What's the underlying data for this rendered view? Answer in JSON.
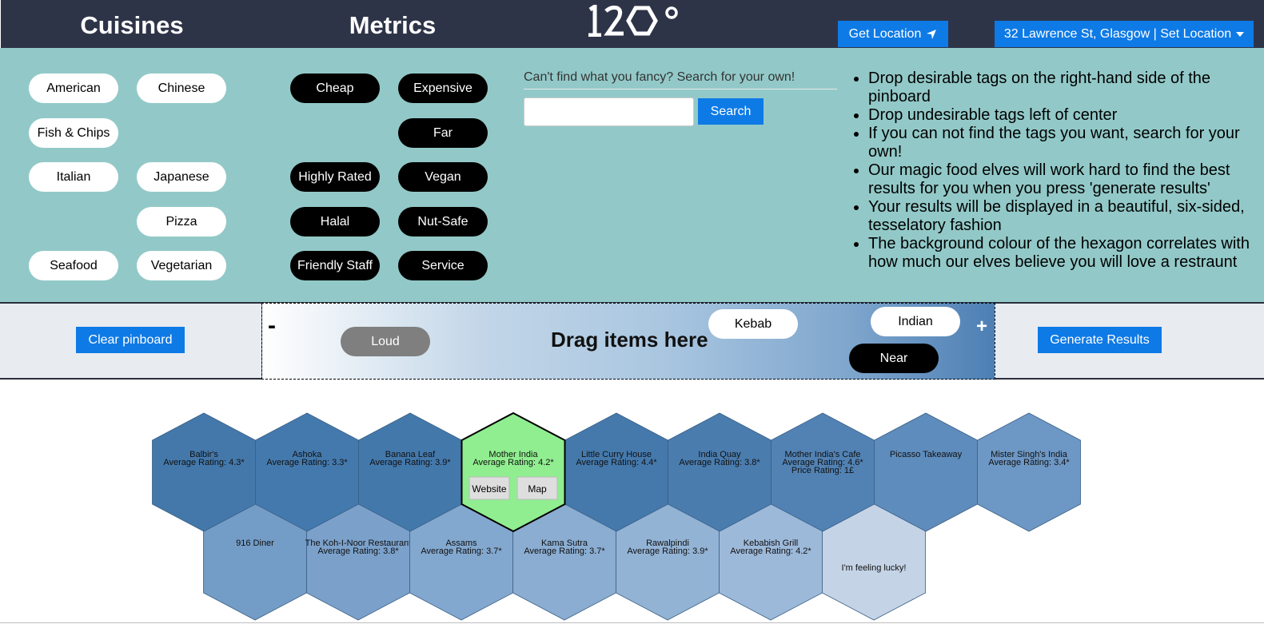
{
  "header": {
    "cuisines_title": "Cuisines",
    "metrics_title": "Metrics",
    "logo_text": "120°",
    "get_location_label": "Get Location",
    "location_label": "32 Lawrence St, Glasgow | Set Location"
  },
  "cuisines": [
    "American",
    "Chinese",
    "Fish & Chips",
    "Italian",
    "Japanese",
    "Pizza",
    "Seafood",
    "Vegetarian"
  ],
  "metrics": [
    "Cheap",
    "Expensive",
    "Far",
    "Highly Rated",
    "Vegan",
    "Halal",
    "Nut-Safe",
    "Friendly Staff",
    "Service"
  ],
  "search": {
    "label": "Can't find what you fancy? Search for your own!",
    "value": "",
    "button_label": "Search"
  },
  "instructions": [
    "Drop desirable tags on the right-hand side of the pinboard",
    "Drop undesirable tags left of center",
    "If you can not find the tags you want, search for your own!",
    "Our magic food elves will work hard to find the best results for you when you press 'generate results'",
    "Your results will be displayed in a beautiful, six-sided, tesselatory fashion",
    "The background colour of the hexagon correlates with how much our elves believe you will love a restraunt"
  ],
  "pinboard": {
    "clear_label": "Clear pinboard",
    "generate_label": "Generate Results",
    "drop_text": "Drag items here",
    "minus": "-",
    "plus": "+",
    "pinned": [
      "Loud",
      "Kebab",
      "Indian",
      "Near"
    ]
  },
  "results": {
    "row1": [
      {
        "name": "Balbir's",
        "rating": "Average Rating: 4.3*",
        "color": "#4478ab"
      },
      {
        "name": "Ashoka",
        "rating": "Average Rating: 3.3*",
        "color": "#4479ad"
      },
      {
        "name": "Banana Leaf",
        "rating": "Average Rating: 3.9*",
        "color": "#4378ab"
      },
      {
        "name": "Mother India",
        "rating": "Average Rating: 4.2*",
        "color": "#90ee90",
        "selected": true,
        "website_label": "Website",
        "map_label": "Map"
      },
      {
        "name": "Little Curry House",
        "rating": "Average Rating: 4.4*",
        "color": "#4579ac"
      },
      {
        "name": "India Quay",
        "rating": "Average Rating: 3.8*",
        "color": "#4a7cae"
      },
      {
        "name": "Mother India's Cafe",
        "rating": "Average Rating: 4.6*",
        "price": "Price Rating: 1£",
        "color": "#5282b4"
      },
      {
        "name": "Picasso Takeaway",
        "rating": "",
        "color": "#5e8cbc"
      },
      {
        "name": "Mister Singh's India",
        "rating": "Average Rating: 3.4*",
        "color": "#6d97c4"
      }
    ],
    "row2": [
      {
        "name": "916 Diner",
        "rating": "",
        "color": "#739cc6"
      },
      {
        "name": "The Koh-I-Noor Restaurant",
        "rating": "Average Rating: 3.8*",
        "color": "#7ba1cb"
      },
      {
        "name": "Assams",
        "rating": "Average Rating: 3.7*",
        "color": "#83a8cf"
      },
      {
        "name": "Kama Sutra",
        "rating": "Average Rating: 3.7*",
        "color": "#8aadd1"
      },
      {
        "name": "Rawalpindi",
        "rating": "Average Rating: 3.9*",
        "color": "#93b3d5"
      },
      {
        "name": "Kebabish Grill",
        "rating": "Average Rating: 4.2*",
        "color": "#9db9da"
      },
      {
        "name": "I'm feeling lucky!",
        "rating": "",
        "color": "#c4d3e6"
      }
    ]
  }
}
